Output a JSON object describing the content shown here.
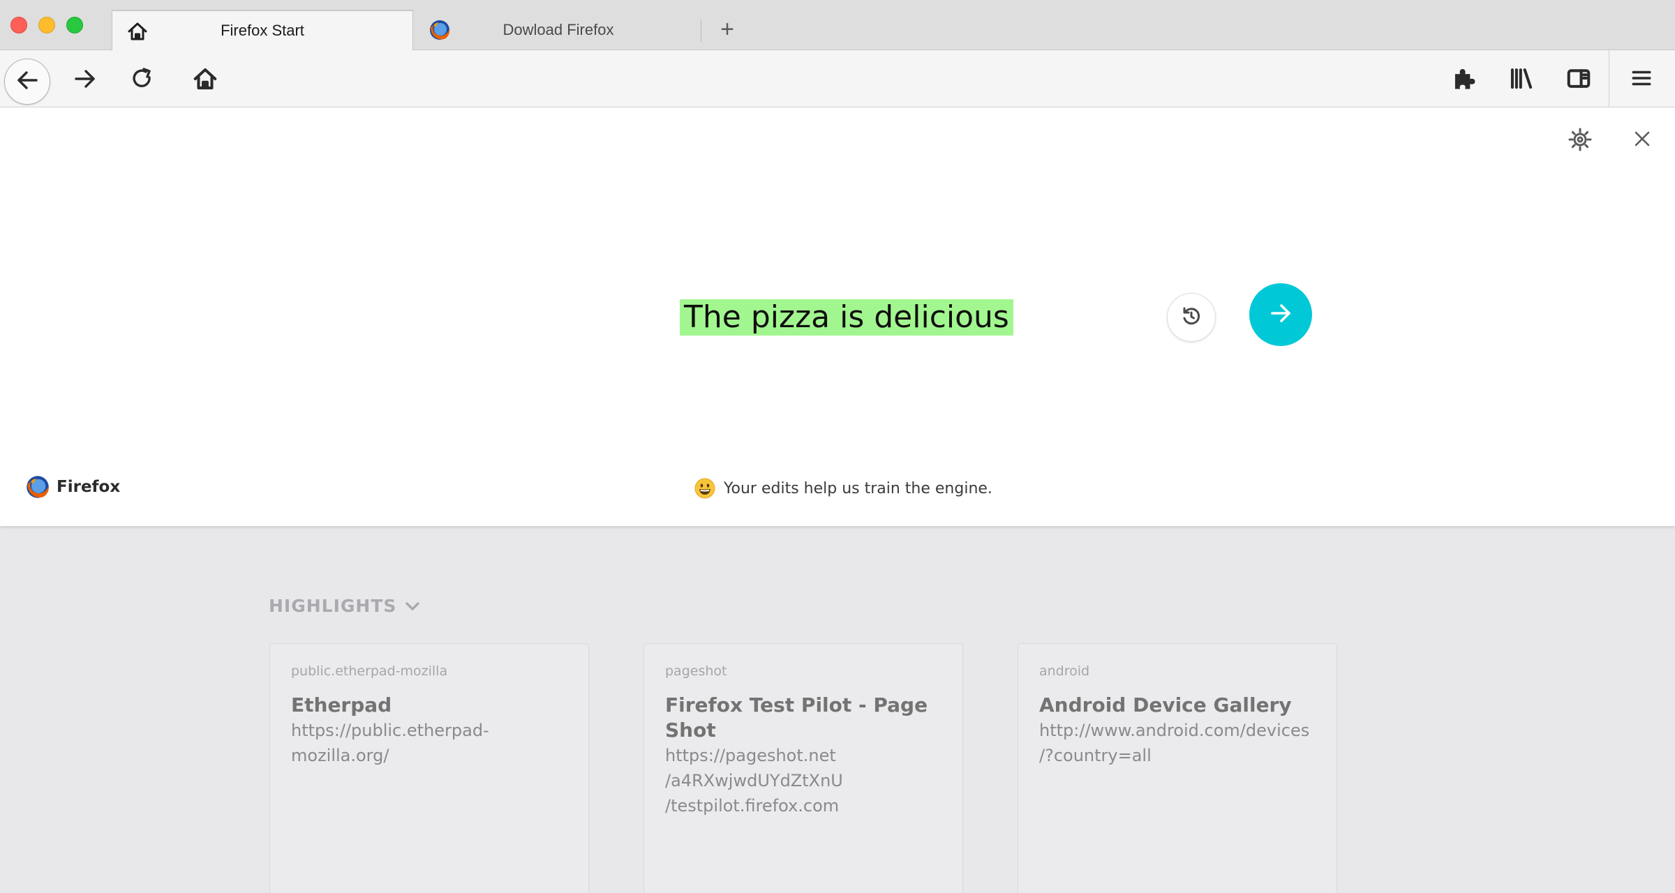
{
  "window": {
    "controls": [
      "close",
      "minimize",
      "zoom"
    ]
  },
  "tabs": [
    {
      "label": "Firefox Start",
      "icon": "home-icon",
      "active": true
    },
    {
      "label": "Dowload Firefox",
      "icon": "firefox-logo-icon",
      "active": false
    }
  ],
  "new_tab_label": "+",
  "toolbar": {
    "left_icons": [
      "back-arrow-icon",
      "forward-arrow-icon",
      "reload-icon",
      "home-icon"
    ],
    "right_icons": [
      "extensions-puzzle-icon",
      "library-icon",
      "sidebar-icon",
      "menu-hamburger-icon"
    ]
  },
  "snippet": {
    "sentence": "The pizza is delicious",
    "highlight_color": "#a2f68f",
    "submit_color": "#00c8d7",
    "brand": "Firefox",
    "footnote": "Your edits help us train the engine.",
    "footnote_emoji": "grinning-face-icon"
  },
  "highlights": {
    "title": "HIGHLIGHTS",
    "cards": [
      {
        "host": "public.etherpad-mozilla",
        "title": "Etherpad",
        "url_lines": [
          "https://public.etherpad-",
          "mozilla.org/"
        ]
      },
      {
        "host": "pageshot",
        "title_lines": [
          "Firefox Test Pilot - Page",
          "Shot"
        ],
        "url_lines": [
          "https://pageshot.net",
          "/a4RXwjwdUYdZtXnU",
          "/testpilot.firefox.com"
        ]
      },
      {
        "host": "android",
        "title": "Android Device Gallery",
        "url_lines": [
          "http://www.android.com/devices",
          "/?country=all"
        ]
      }
    ]
  }
}
